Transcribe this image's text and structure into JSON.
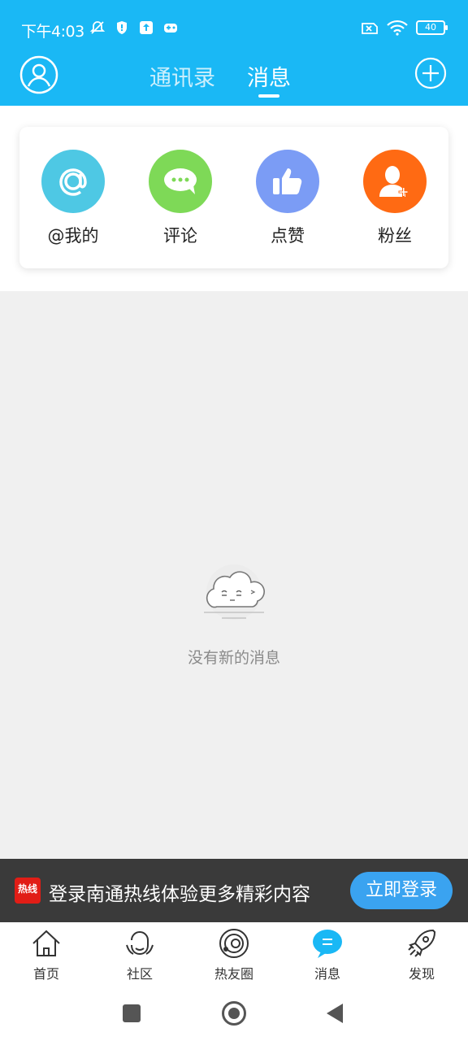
{
  "status_bar": {
    "time": "下午4:03",
    "battery": "40",
    "icons": [
      "notification-muted-icon",
      "shield-icon",
      "upload-icon",
      "gamepad-icon",
      "sim-icon",
      "wifi-icon",
      "battery-icon"
    ]
  },
  "header": {
    "tabs": [
      {
        "label": "通讯录",
        "active": false
      },
      {
        "label": "消息",
        "active": true
      }
    ],
    "left_icon": "user-avatar-icon",
    "right_icon": "plus-circle-icon"
  },
  "categories": [
    {
      "label": "@我的",
      "icon": "at-icon",
      "color": "#4ec8e4"
    },
    {
      "label": "评论",
      "icon": "comment-icon",
      "color": "#7ed957"
    },
    {
      "label": "点赞",
      "icon": "thumbs-up-icon",
      "color": "#7b9cf5"
    },
    {
      "label": "粉丝",
      "icon": "add-fan-icon",
      "color": "#ff6a13"
    }
  ],
  "empty_state": {
    "text": "没有新的消息"
  },
  "login_banner": {
    "logo_text": "热线",
    "message": "登录南通热线体验更多精彩内容",
    "button": "立即登录"
  },
  "bottom_nav": [
    {
      "label": "首页",
      "icon": "home-icon",
      "active": false
    },
    {
      "label": "社区",
      "icon": "community-icon",
      "active": false
    },
    {
      "label": "热友圈",
      "icon": "friends-circle-icon",
      "active": false
    },
    {
      "label": "消息",
      "icon": "message-icon",
      "active": true
    },
    {
      "label": "发现",
      "icon": "rocket-icon",
      "active": false
    }
  ],
  "colors": {
    "brand": "#1ab8f5",
    "banner_bg": "#3a3a3a",
    "login_button": "#3aa3f0"
  }
}
